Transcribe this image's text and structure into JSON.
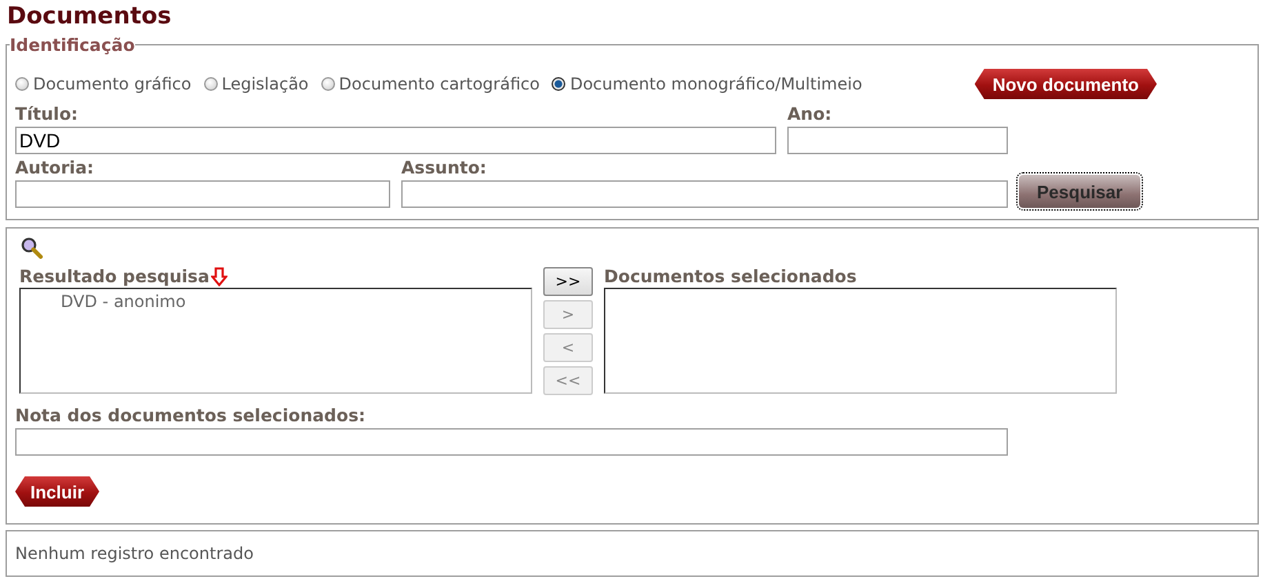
{
  "page_title": "Documentos",
  "identification": {
    "legend": "Identificação",
    "doc_types": [
      {
        "label": "Documento gráfico",
        "selected": false
      },
      {
        "label": "Legislação",
        "selected": false
      },
      {
        "label": "Documento cartográfico",
        "selected": false
      },
      {
        "label": "Documento monográfico/Multimeio",
        "selected": true
      }
    ],
    "new_button": "Novo documento",
    "title_field": {
      "label": "Título:",
      "value": "DVD"
    },
    "year_field": {
      "label": "Ano:"
    },
    "author_field": {
      "label": "Autoria:"
    },
    "subject_field": {
      "label": "Assunto:"
    },
    "search_button": {
      "label": "Pesquisar",
      "focused": true
    }
  },
  "selection": {
    "results": {
      "label": "Resultado pesquisa",
      "items": [
        "DVD - anonimo"
      ]
    },
    "transfer_buttons": [
      {
        "label": ">>",
        "disabled": false
      },
      {
        "label": ">",
        "disabled": true
      },
      {
        "label": "<",
        "disabled": true
      },
      {
        "label": "<<",
        "disabled": true
      }
    ],
    "selected_docs": {
      "label": "Documentos selecionados"
    },
    "note_field": {
      "label": "Nota dos documentos selecionados:"
    },
    "include_button": "Incluir"
  },
  "status_message": "Nenhum registro encontrado"
}
